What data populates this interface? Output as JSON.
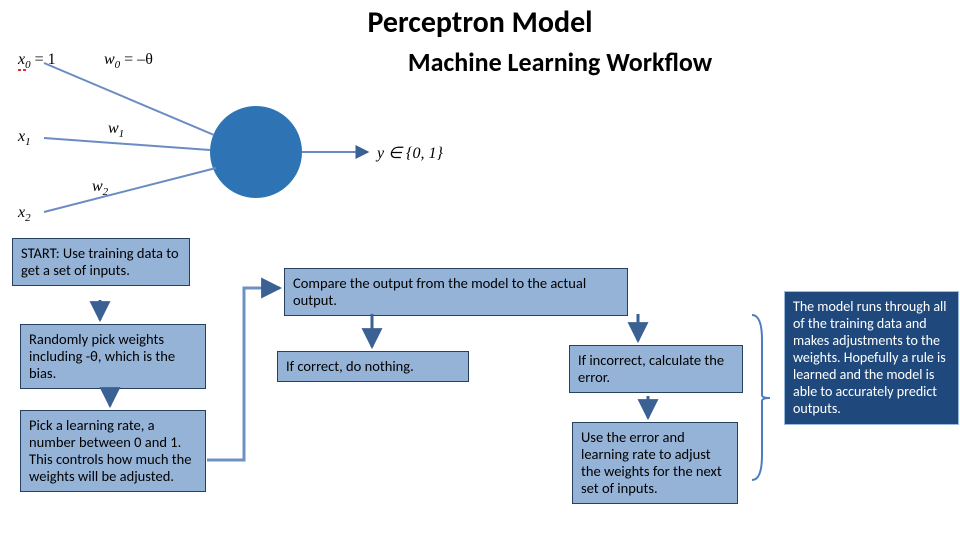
{
  "title": "Perceptron Model",
  "subtitle": "Machine Learning Workflow",
  "labels": {
    "x0": "x",
    "x0sub": "0",
    "x0eq": " = 1",
    "w0": "w",
    "w0sub": "0",
    "w0eq": " = –θ",
    "x1": "x",
    "x1sub": "1",
    "w1": "w",
    "w1sub": "1",
    "w2": "w",
    "w2sub": "2",
    "x2": "x",
    "x2sub": "2",
    "output": "y ∈ {0, 1}"
  },
  "boxes": {
    "start": "START: Use training data to get a set of inputs.",
    "weights": "Randomly pick weights including -θ, which is the bias.",
    "lr": "Pick a learning rate, a number between 0 and 1. This controls how much the weights will be adjusted.",
    "compare": "Compare the output from the model to the actual output.",
    "correct": "If correct, do nothing.",
    "incorrect": "If incorrect, calculate the error.",
    "use_error": "Use the error and learning rate to adjust the weights for the next set of inputs.",
    "summary": "The model runs through all of the training data and makes adjustments to the weights. Hopefully a rule is learned and the model is able to accurately predict outputs."
  }
}
